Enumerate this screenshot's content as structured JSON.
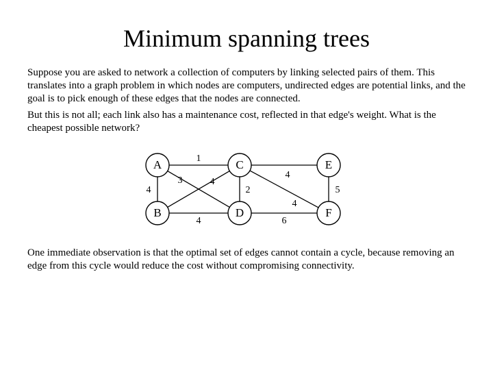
{
  "title": "Minimum spanning trees",
  "para1": "Suppose you are asked to network a collection of computers by linking selected pairs of them. This translates into a graph problem in which nodes are computers, undirected edges are potential links, and the goal is to pick enough of these edges that the nodes are connected.",
  "para2": "But this is not all; each link also has a maintenance cost, reflected in that edge's weight. What is the cheapest possible network?",
  "para3": "One immediate observation is that the optimal set of edges cannot contain a cycle, because removing an edge from this cycle would reduce the cost without compromising connectivity.",
  "graph": {
    "nodes": {
      "A": "A",
      "B": "B",
      "C": "C",
      "D": "D",
      "E": "E",
      "F": "F"
    },
    "weights": {
      "AC": "1",
      "AB": "4",
      "AD": "3",
      "BC": "4",
      "BD": "4",
      "CD": "2",
      "CE": "4",
      "CF": "4",
      "DF": "6",
      "EF": "5"
    }
  }
}
